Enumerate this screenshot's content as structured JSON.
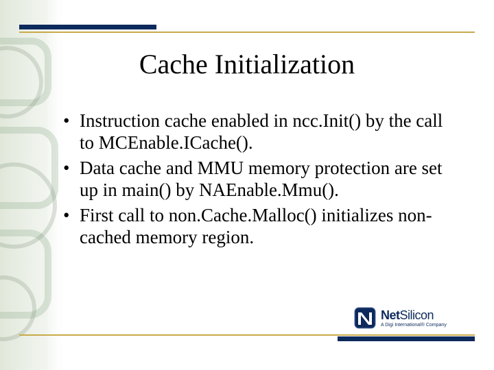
{
  "title": "Cache Initialization",
  "bullets": {
    "b0": "Instruction cache enabled in ncc.Init() by the call to MCEnable.ICache().",
    "b1": "Data cache and MMU memory protection are set up in main() by NAEnable.Mmu().",
    "b2": "First call to non.Cache.Malloc() initializes non-cached memory region."
  },
  "logo": {
    "name_prefix": "Net",
    "name_suffix": "Silicon",
    "tagline": "A Digi International® Company"
  },
  "colors": {
    "navy": "#0d2a5c",
    "gold": "#c9a94a"
  }
}
